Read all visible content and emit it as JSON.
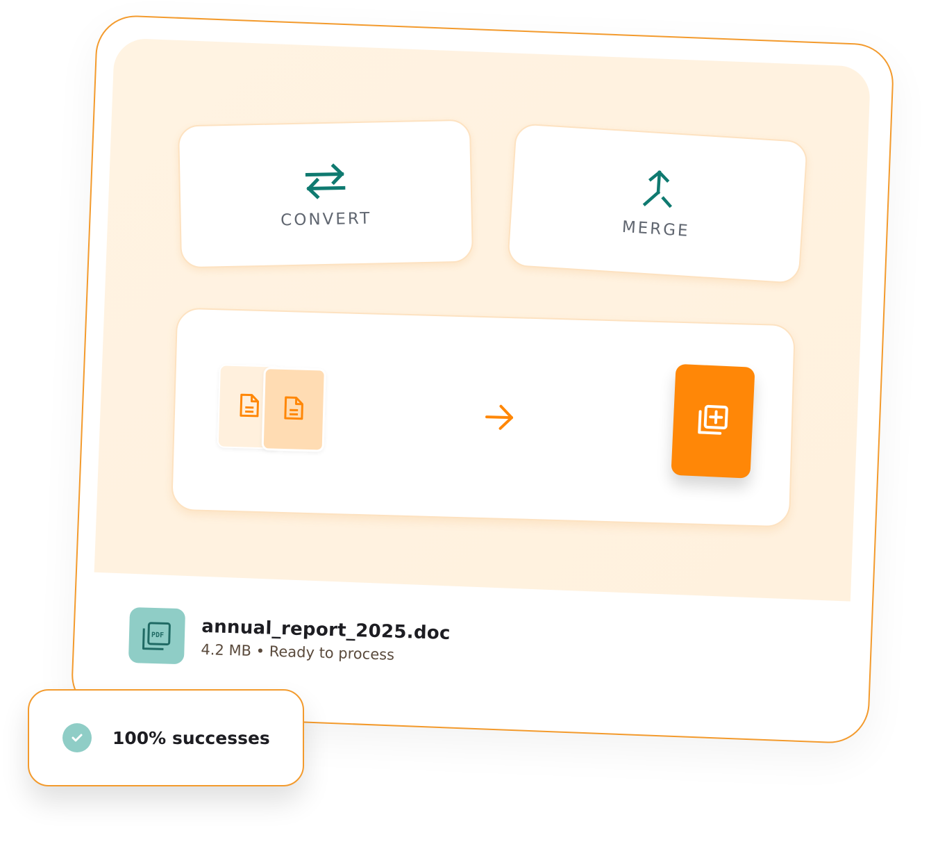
{
  "actions": {
    "convert": {
      "label": "CONVERT",
      "icon": "swap-arrows-icon"
    },
    "merge": {
      "label": "MERGE",
      "icon": "merge-arrow-icon"
    }
  },
  "process": {
    "source_icons": [
      "document-icon",
      "document-icon"
    ],
    "arrow_icon": "arrow-right-icon",
    "result_icon": "add-library-icon"
  },
  "file": {
    "name": "annual_report_2025.doc",
    "size": "4.2 MB",
    "separator": "•",
    "status": "Ready to process",
    "icon": "pdf-stack-icon"
  },
  "badge": {
    "text": "100% successes",
    "icon": "check-circle-icon"
  },
  "colors": {
    "accent_orange": "#ff8707",
    "border_orange": "#f39a2c",
    "teal": "#0f7a70",
    "teal_light": "#8fcdc6",
    "peach_bg": "#fff3e2"
  }
}
